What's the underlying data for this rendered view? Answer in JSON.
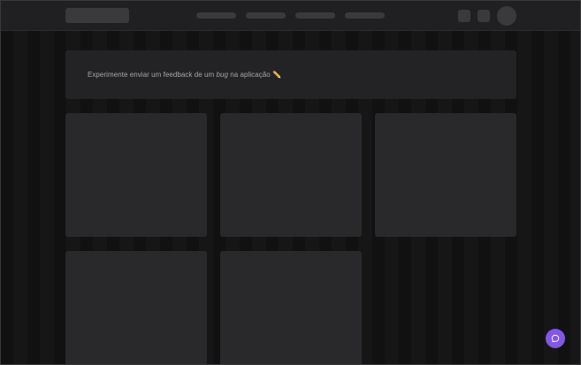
{
  "banner": {
    "text_before": "Experimente enviar um feedback de um ",
    "text_em": "bug",
    "text_after": " na aplicação ",
    "emoji": "✏️"
  },
  "icons": {
    "feedback_button": "chat-bubble-icon",
    "banner_emoji": "pencil-icon"
  },
  "colors": {
    "background": "#111112",
    "header": "#202022",
    "banner": "#232325",
    "card": "#29292b",
    "skeleton": "#3a3a3d",
    "accent": "#8257e5"
  }
}
